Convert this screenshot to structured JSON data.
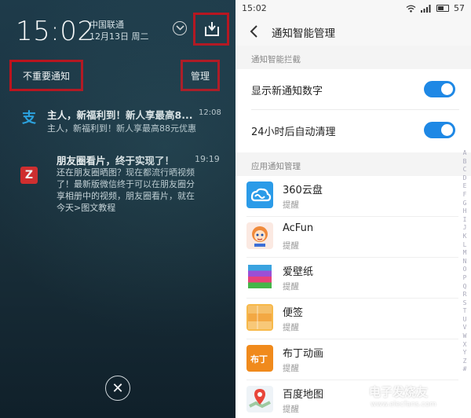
{
  "left_panel": {
    "clock": "15:02",
    "carrier": "中国联通",
    "date": "12月13日 周二",
    "unimportant_label": "不重要通知",
    "manage_label": "管理",
    "notifications": [
      {
        "title": "主人，新福利到！新人享最高8...",
        "body": "主人，新福利到！新人享最高88元优惠，",
        "time": "12:08",
        "icon": "alipay-icon",
        "color": "#2aa6e6"
      },
      {
        "title": "朋友圈看片，终于实现了！",
        "body": "还在朋友圈晒图？现在都流行晒视频了！最新版微信终于可以在朋友圈分享相册中的视频，朋友圈看片，就在今天>图文教程",
        "time": "19:19",
        "icon": "z-app-icon",
        "color": "#d92a2a"
      }
    ],
    "close_icon": "close-icon"
  },
  "right_panel": {
    "status": {
      "time": "15:02",
      "battery": "57",
      "battery_level": 0.57
    },
    "header_title": "通知智能管理",
    "section_smart": "通知智能拦截",
    "settings": [
      {
        "label": "显示新通知数字",
        "on": true
      },
      {
        "label": "24小时后自动清理",
        "on": true
      }
    ],
    "section_apps": "应用通知管理",
    "apps": [
      {
        "name": "360云盘",
        "status": "提醒",
        "icon": "cloud-icon"
      },
      {
        "name": "AcFun",
        "status": "提醒",
        "icon": "acfun-icon"
      },
      {
        "name": "爱壁纸",
        "status": "提醒",
        "icon": "wallpaper-icon"
      },
      {
        "name": "便签",
        "status": "提醒",
        "icon": "notes-icon"
      },
      {
        "name": "布丁动画",
        "status": "提醒",
        "icon": "budding-icon"
      },
      {
        "name": "百度地图",
        "status": "提醒",
        "icon": "map-icon"
      }
    ],
    "alphabet": "A B C D E F G H I J K L M N O P Q R S T U V W X Y Z #",
    "accent": "#1e88e5"
  },
  "watermark": {
    "text": "电子发烧友",
    "url": "www.elecfans.com"
  }
}
